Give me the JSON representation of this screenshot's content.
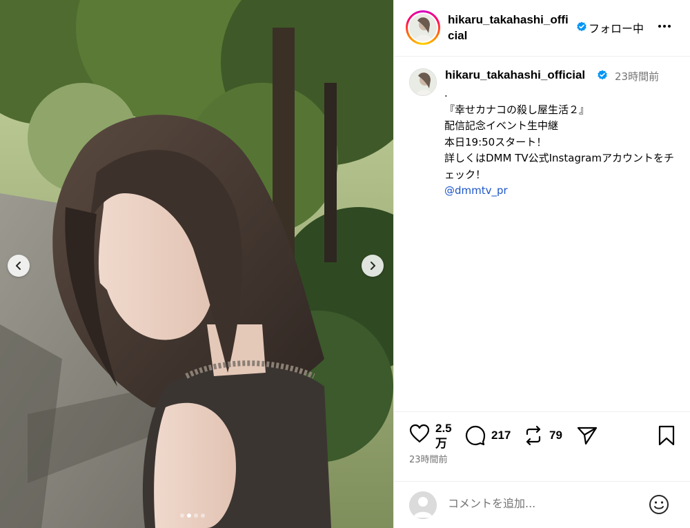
{
  "post": {
    "username": "hikaru_takahashi_official",
    "follow_label": "フォロー中",
    "relative_time": "23時間前",
    "caption_lines": [
      ".",
      "『幸せカナコの殺し屋生活２』",
      "配信記念イベント生中継",
      "本日19:50スタート！",
      "",
      "詳しくはDMM TV公式Instagramアカウントをチェック！"
    ],
    "mention": "@dmmtv_pr",
    "likes": "2.5万",
    "comments": "217",
    "reposts": "79",
    "post_time": "23時間前"
  },
  "comment_box": {
    "placeholder": "コメントを追加..."
  },
  "carousel": {
    "total": 4,
    "active_index": 1
  },
  "icons": {
    "verified": "verified-badge-icon",
    "more": "more-options-icon",
    "like": "heart-icon",
    "comment": "comment-bubble-icon",
    "repost": "repost-icon",
    "share": "share-paper-plane-icon",
    "save": "bookmark-icon",
    "emoji": "emoji-smile-icon",
    "prev": "chevron-left-icon",
    "next": "chevron-right-icon"
  },
  "colors": {
    "verified_blue": "#0095f6",
    "mention_blue": "#1c55c7",
    "muted_text": "#737373"
  }
}
